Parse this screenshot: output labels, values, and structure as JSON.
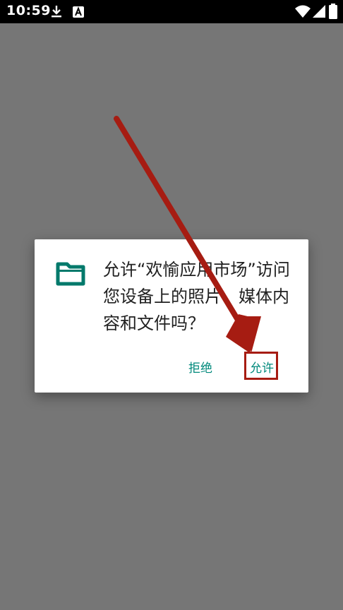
{
  "status_bar": {
    "time": "10:59",
    "icons": [
      "download-icon",
      "font-a-icon",
      "wifi-icon",
      "signal-icon",
      "battery-icon"
    ]
  },
  "dialog": {
    "message": "允许“欢愉应用市场”访问您设备上的照片、媒体内容和文件吗？",
    "deny_label": "拒绝",
    "allow_label": "允许"
  },
  "colors": {
    "accent": "#00897b",
    "annotation": "#a61c12",
    "scrim": "#767676"
  }
}
